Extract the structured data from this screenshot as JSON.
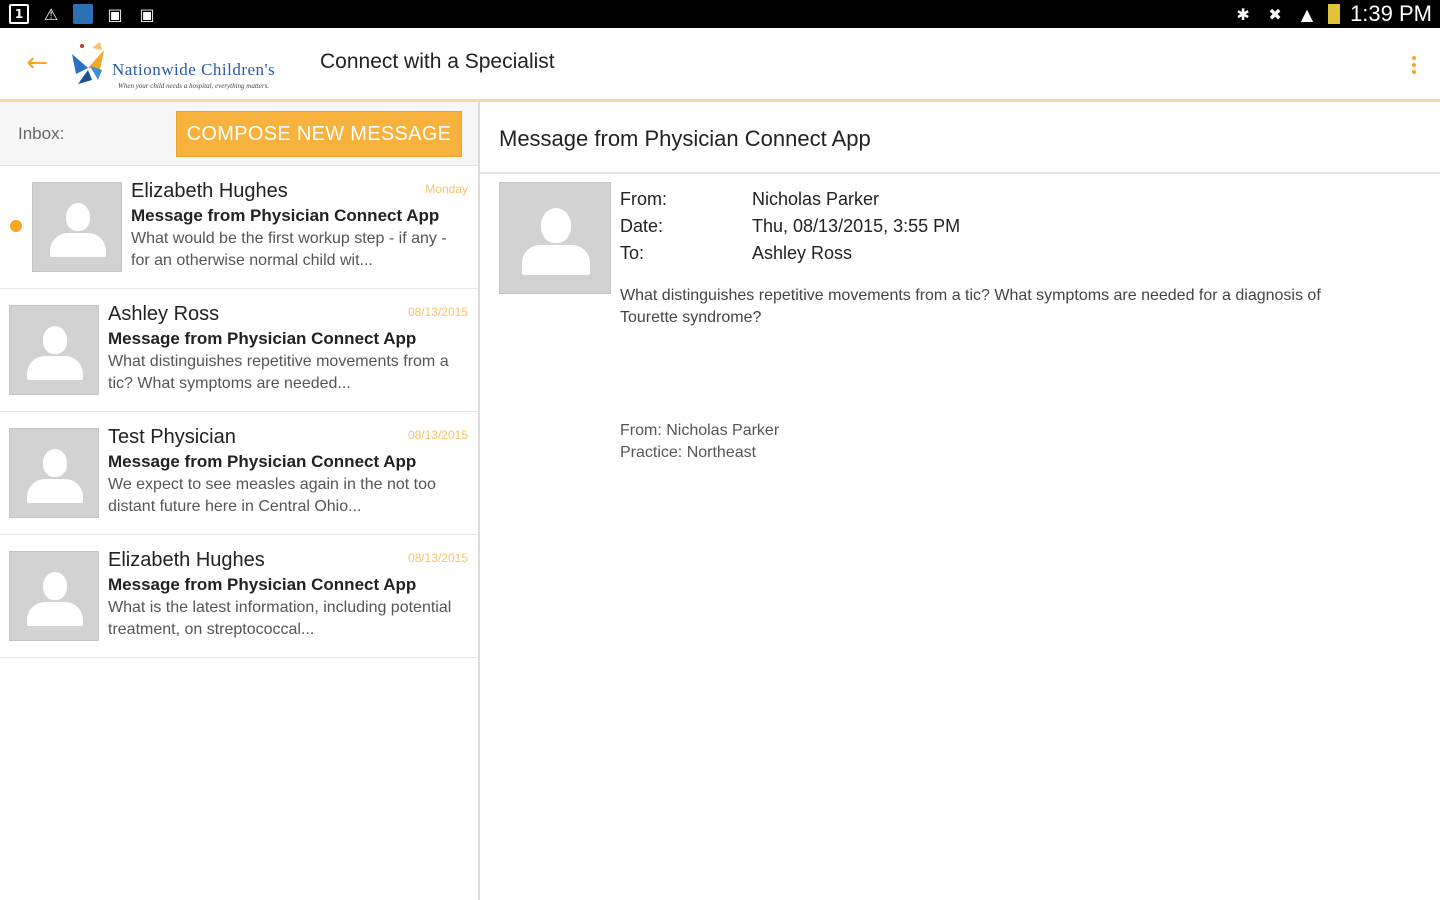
{
  "status_bar": {
    "time": "1:39 PM",
    "left_icons": [
      "notification-1-icon",
      "warning-icon",
      "news-icon",
      "camera-icon",
      "camera-icon"
    ],
    "right_icons": [
      "bluetooth-icon",
      "mute-icon",
      "wifi-icon",
      "battery-icon"
    ]
  },
  "action_bar": {
    "title": "Connect with a Specialist",
    "logo_text": "Nationwide Children's",
    "logo_tagline": "When your child needs a hospital, everything matters.",
    "accent_color": "#f5a623"
  },
  "inbox": {
    "label": "Inbox:",
    "compose_label": "COMPOSE NEW MESSAGE",
    "messages": [
      {
        "sender": "Elizabeth Hughes",
        "date": "Monday",
        "subject": "Message from Physician Connect App",
        "preview": "What would be the first workup step - if any - for an otherwise normal child wit...",
        "unread": true
      },
      {
        "sender": "Ashley Ross",
        "date": "08/13/2015",
        "subject": "Message from Physician Connect App",
        "preview": "What distinguishes repetitive movements from a tic? What symptoms are needed...",
        "unread": false
      },
      {
        "sender": "Test Physician",
        "date": "08/13/2015",
        "subject": "Message from Physician Connect App",
        "preview": "We expect to see measles again in the not too distant future here in Central Ohio...",
        "unread": false
      },
      {
        "sender": "Elizabeth Hughes",
        "date": "08/13/2015",
        "subject": "Message from Physician Connect App",
        "preview": "What is the latest information, including potential treatment, on streptococcal...",
        "unread": false
      }
    ]
  },
  "detail": {
    "title": "Message from Physician Connect App",
    "from_label": "From:",
    "from_value": "Nicholas Parker",
    "date_label": "Date:",
    "date_value": "Thu, 08/13/2015, 3:55 PM",
    "to_label": "To:",
    "to_value": "Ashley Ross",
    "body": "What distinguishes repetitive movements from a tic? What symptoms are needed for a diagnosis of Tourette syndrome?",
    "signature_from": "From: Nicholas Parker",
    "signature_practice": "Practice: Northeast"
  }
}
